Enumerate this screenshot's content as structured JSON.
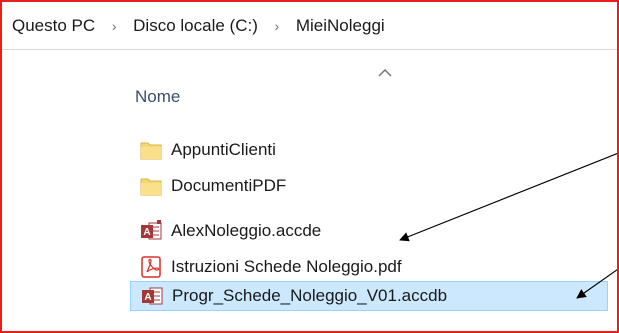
{
  "breadcrumb": {
    "items": [
      "Questo PC",
      "Disco locale (C:)",
      "MieiNoleggi"
    ],
    "separator": "›"
  },
  "file_list": {
    "column_header": "Nome",
    "sort": "ascending",
    "items": [
      {
        "name": "AppuntiClienti",
        "icon": "folder-icon",
        "selected": false
      },
      {
        "name": "DocumentiPDF",
        "icon": "folder-icon",
        "selected": false
      },
      {
        "name": "AlexNoleggio.accde",
        "icon": "access-accde-icon",
        "selected": false
      },
      {
        "name": "Istruzioni Schede Noleggio.pdf",
        "icon": "pdf-icon",
        "selected": false
      },
      {
        "name": "Progr_Schede_Noleggio_V01.accdb",
        "icon": "access-accdb-icon",
        "selected": true
      }
    ]
  },
  "colors": {
    "frame_border": "#e8201c",
    "selection_bg": "#cce8ff",
    "selection_border": "#99d1ff",
    "header_text": "#3d4e6b",
    "folder": "#f7d774",
    "access_red": "#a4373a",
    "pdf_red": "#d9302a"
  },
  "annotations": {
    "arrows": 2,
    "arrow_targets": [
      "AlexNoleggio.accde",
      "Progr_Schede_Noleggio_V01.accdb"
    ]
  }
}
